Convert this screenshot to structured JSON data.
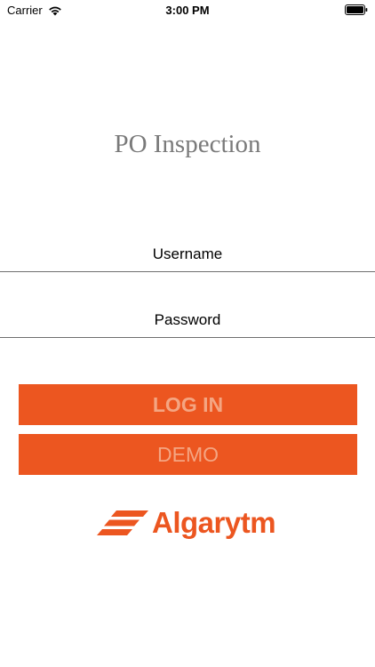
{
  "status_bar": {
    "carrier": "Carrier",
    "time": "3:00 PM",
    "wifi_icon": "wifi-icon",
    "battery_icon": "battery-icon"
  },
  "app": {
    "title": "PO Inspection"
  },
  "form": {
    "username": {
      "placeholder": "Username",
      "value": ""
    },
    "password": {
      "placeholder": "Password",
      "value": ""
    }
  },
  "buttons": {
    "login_label": "LOG IN",
    "demo_label": "DEMO"
  },
  "logo": {
    "text": "Algarytm",
    "icon": "algarytm-logo-mark"
  },
  "colors": {
    "accent": "#ec5620",
    "button_text": "#f4a582",
    "title": "#7a7a7a"
  }
}
